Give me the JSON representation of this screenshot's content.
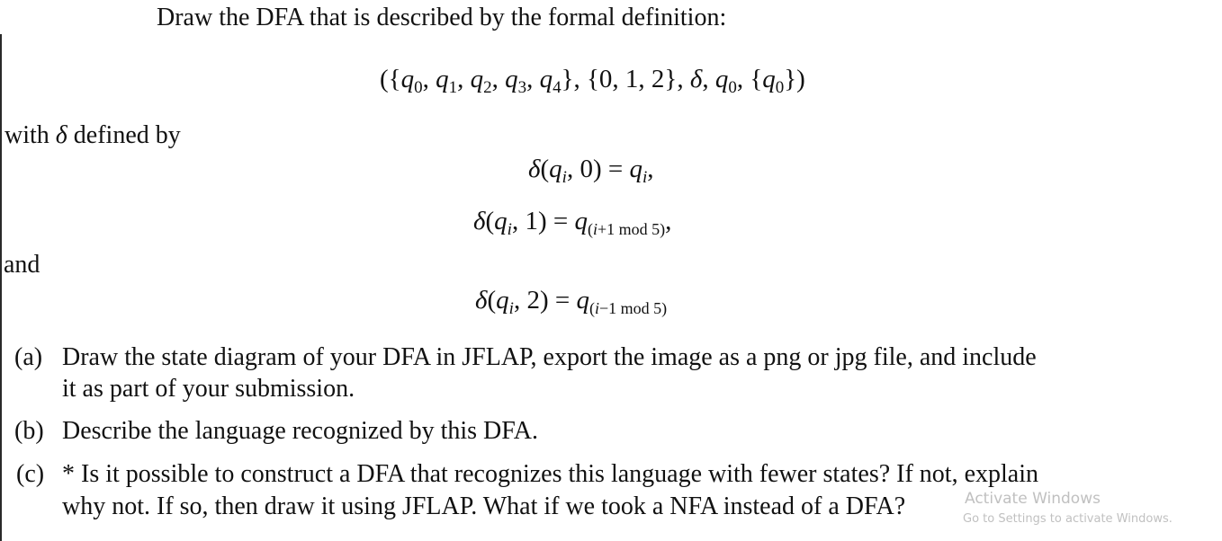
{
  "document": {
    "intro": "Draw the DFA that is described by the formal definition:",
    "tuple": {
      "open": "({",
      "states": [
        "q",
        "0",
        "q",
        "1",
        "q",
        "2",
        "q",
        "3",
        "q",
        "4"
      ],
      "text": "({q0, q1, q2, q3, q4}, {0, 1, 2}, δ, q0, {q0})"
    },
    "with_line": "with δ defined by",
    "equations": [
      {
        "text": "δ(qi, 0) = qi,",
        "lhs": "δ(",
        "q": "q",
        "i": "i",
        "input": ", 0) = ",
        "rhs_q": "q",
        "rhs_sub": "i",
        "trail": ","
      },
      {
        "text": "δ(qi, 1) = q(i+1 mod 5),",
        "lhs": "δ(",
        "q": "q",
        "i": "i",
        "input": ", 1) = ",
        "rhs_q": "q",
        "rhs_sub": "(i+1 mod 5)",
        "trail": ","
      },
      {
        "text": "δ(qi, 2) = q(i−1 mod 5)",
        "lhs": "δ(",
        "q": "q",
        "i": "i",
        "input": ", 2) = ",
        "rhs_q": "q",
        "rhs_sub": "(i−1 mod 5)",
        "trail": ""
      }
    ],
    "and_line": "and",
    "questions": [
      {
        "label": "(a)",
        "lines": [
          "Draw the state diagram of your DFA in JFLAP, export the image as a png or jpg file, and include",
          "it as part of your submission."
        ]
      },
      {
        "label": "(b)",
        "lines": [
          "Describe the language recognized by this DFA."
        ]
      },
      {
        "label": "(c)",
        "lines": [
          "* Is it possible to construct a DFA that recognizes this language with fewer states? If not, explain",
          "why not. If so, then draw it using JFLAP. What if we took a NFA instead of a DFA?"
        ]
      }
    ]
  },
  "watermark": {
    "title": "Activate Windows",
    "subtitle": "Go to Settings to activate Windows."
  }
}
